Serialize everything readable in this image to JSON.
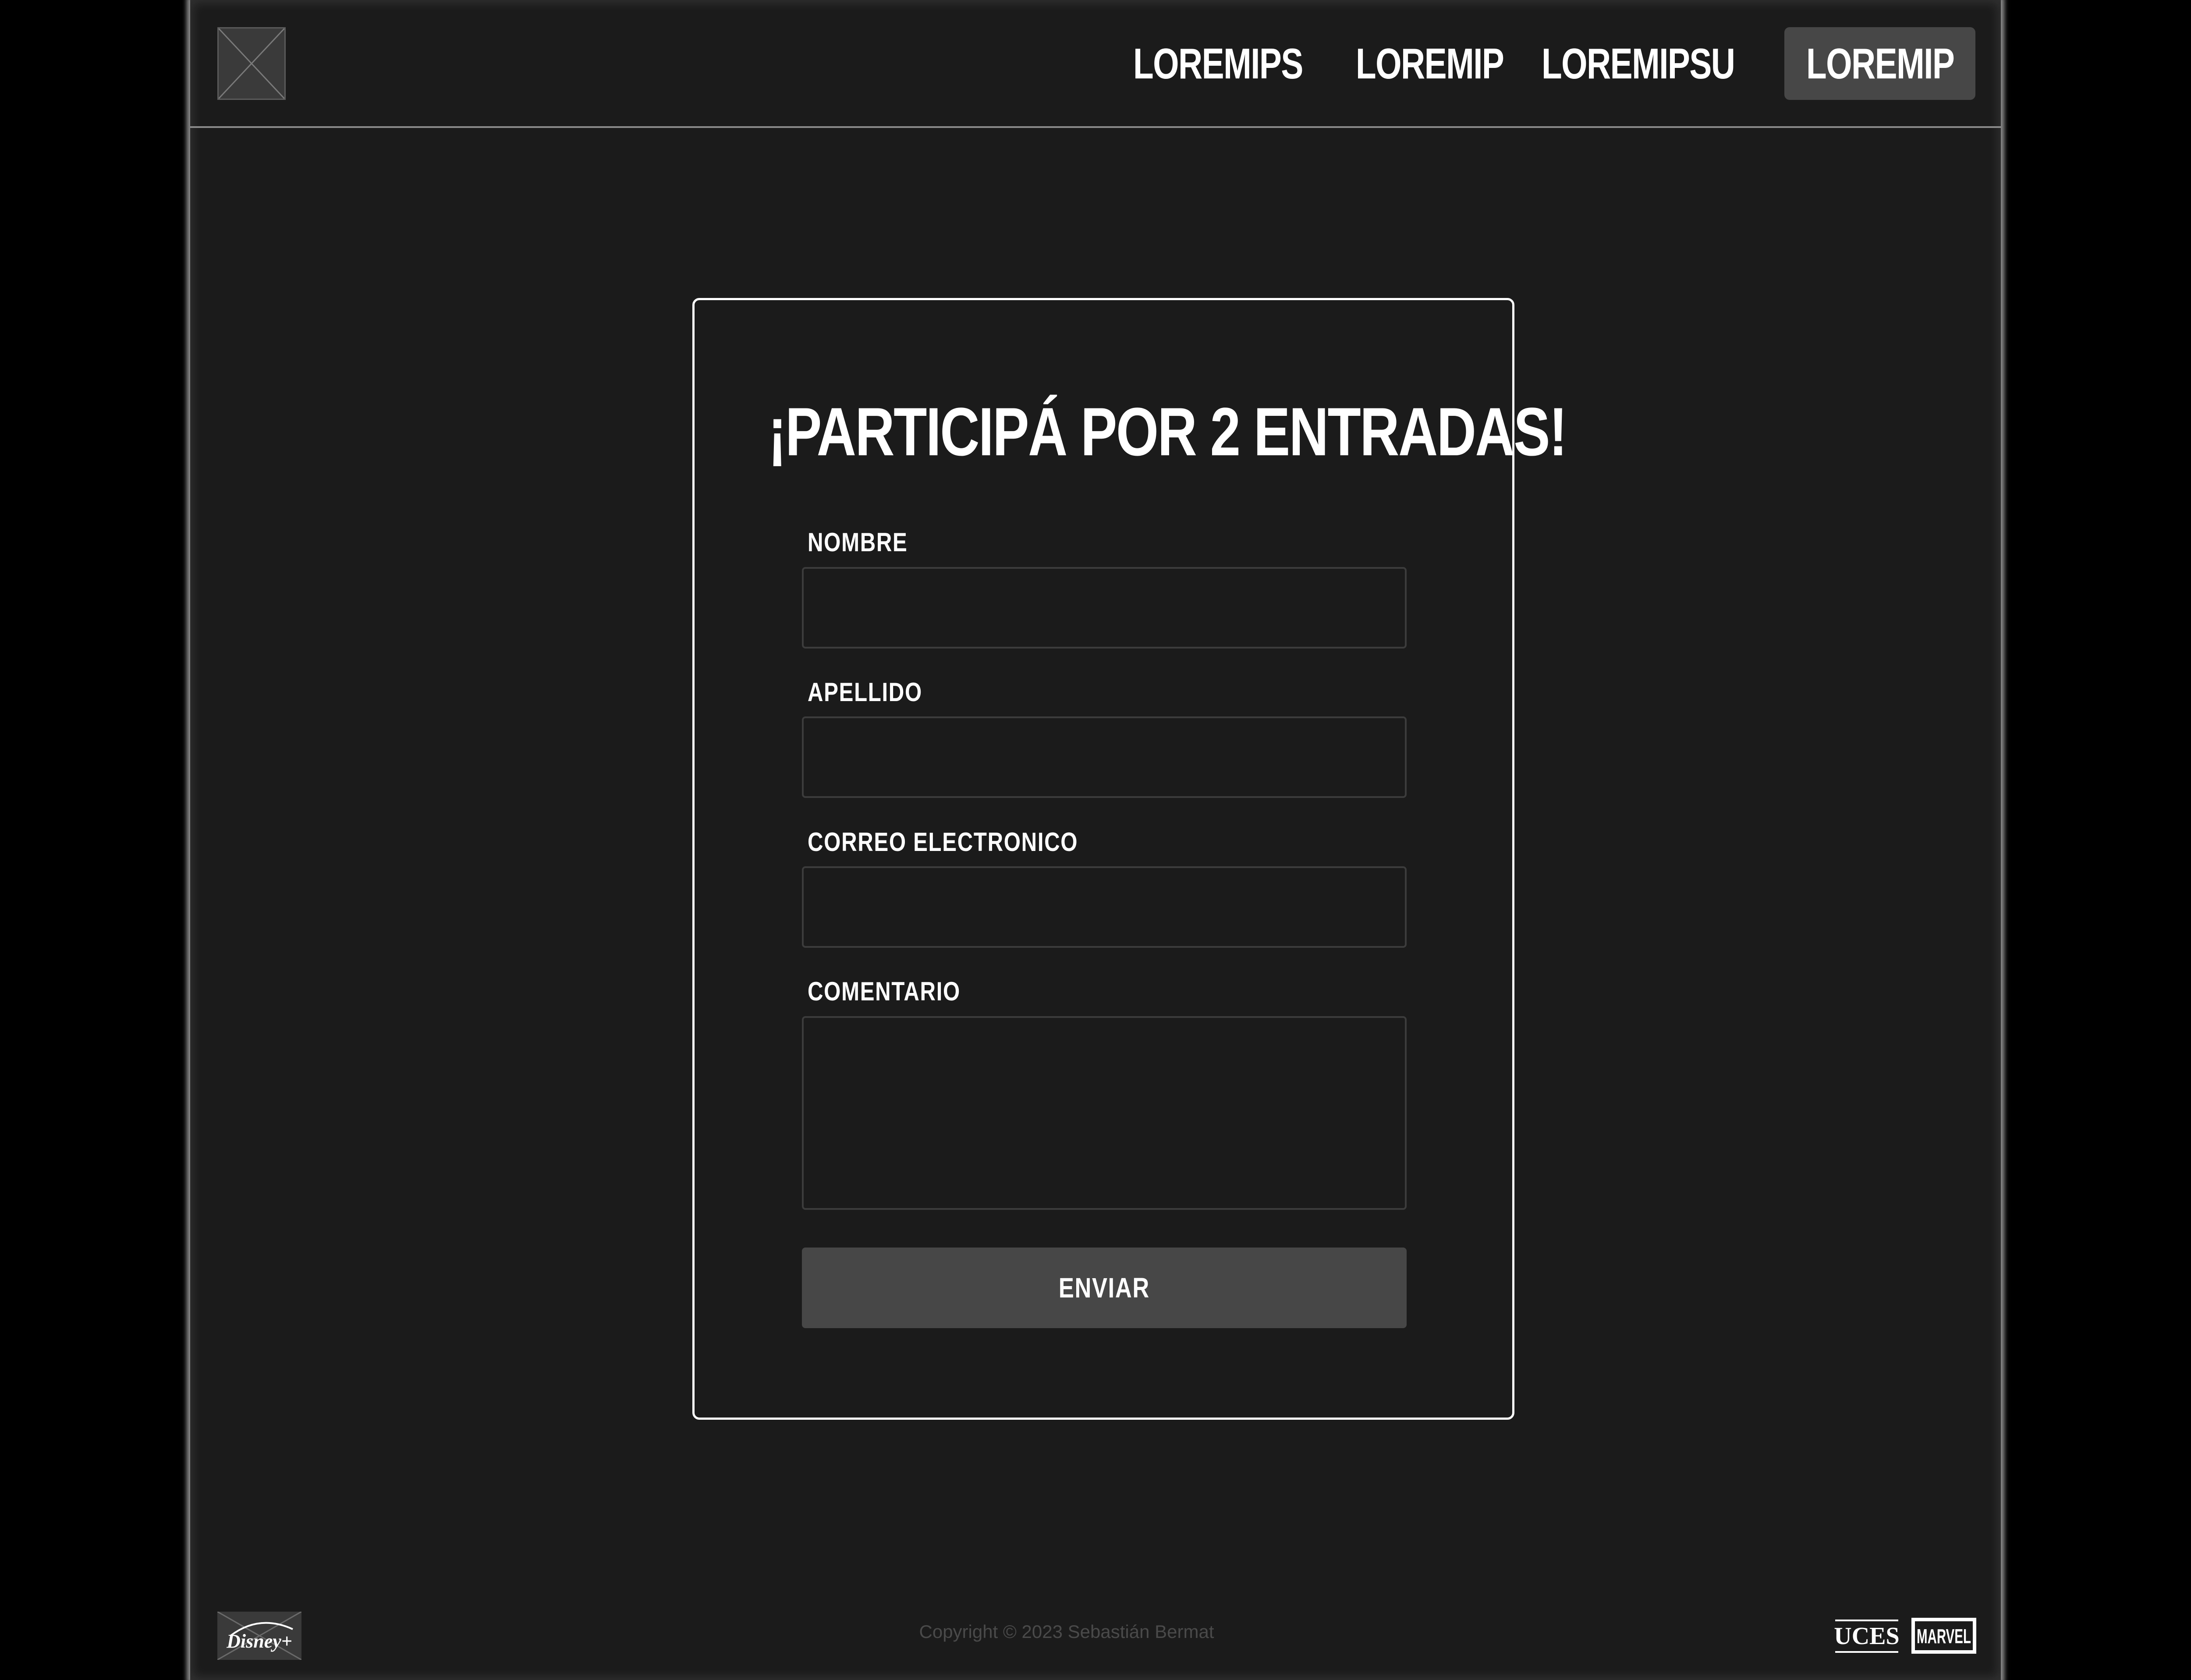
{
  "header": {
    "nav": [
      {
        "label": "LOREMIPS"
      },
      {
        "label": "LOREMIP"
      },
      {
        "label": "LOREMIPSU"
      },
      {
        "label": "LOREMIP",
        "active": true
      }
    ]
  },
  "form": {
    "title": "¡PARTICIPÁ POR 2 ENTRADAS!",
    "fields": [
      {
        "label": "NOMBRE",
        "value": ""
      },
      {
        "label": "APELLIDO",
        "value": ""
      },
      {
        "label": "CORREO ELECTRONICO",
        "value": ""
      },
      {
        "label": "COMENTARIO",
        "value": ""
      }
    ],
    "submit_label": "ENVIAR"
  },
  "footer": {
    "copyright": "Copyright © 2023 Sebastián Bermat",
    "logos": {
      "left": {
        "icon": "disney-plus-logo",
        "text": "Disney+"
      },
      "right": [
        {
          "icon": "uces-logo",
          "text": "UCES"
        },
        {
          "icon": "marvel-logo",
          "text": "MARVEL"
        }
      ]
    }
  },
  "colors": {
    "page_bg": "#1b1b1b",
    "outer_bg": "#000000",
    "accent_button": "#474747",
    "text": "#ffffff",
    "input_border": "#3c3c3c"
  }
}
